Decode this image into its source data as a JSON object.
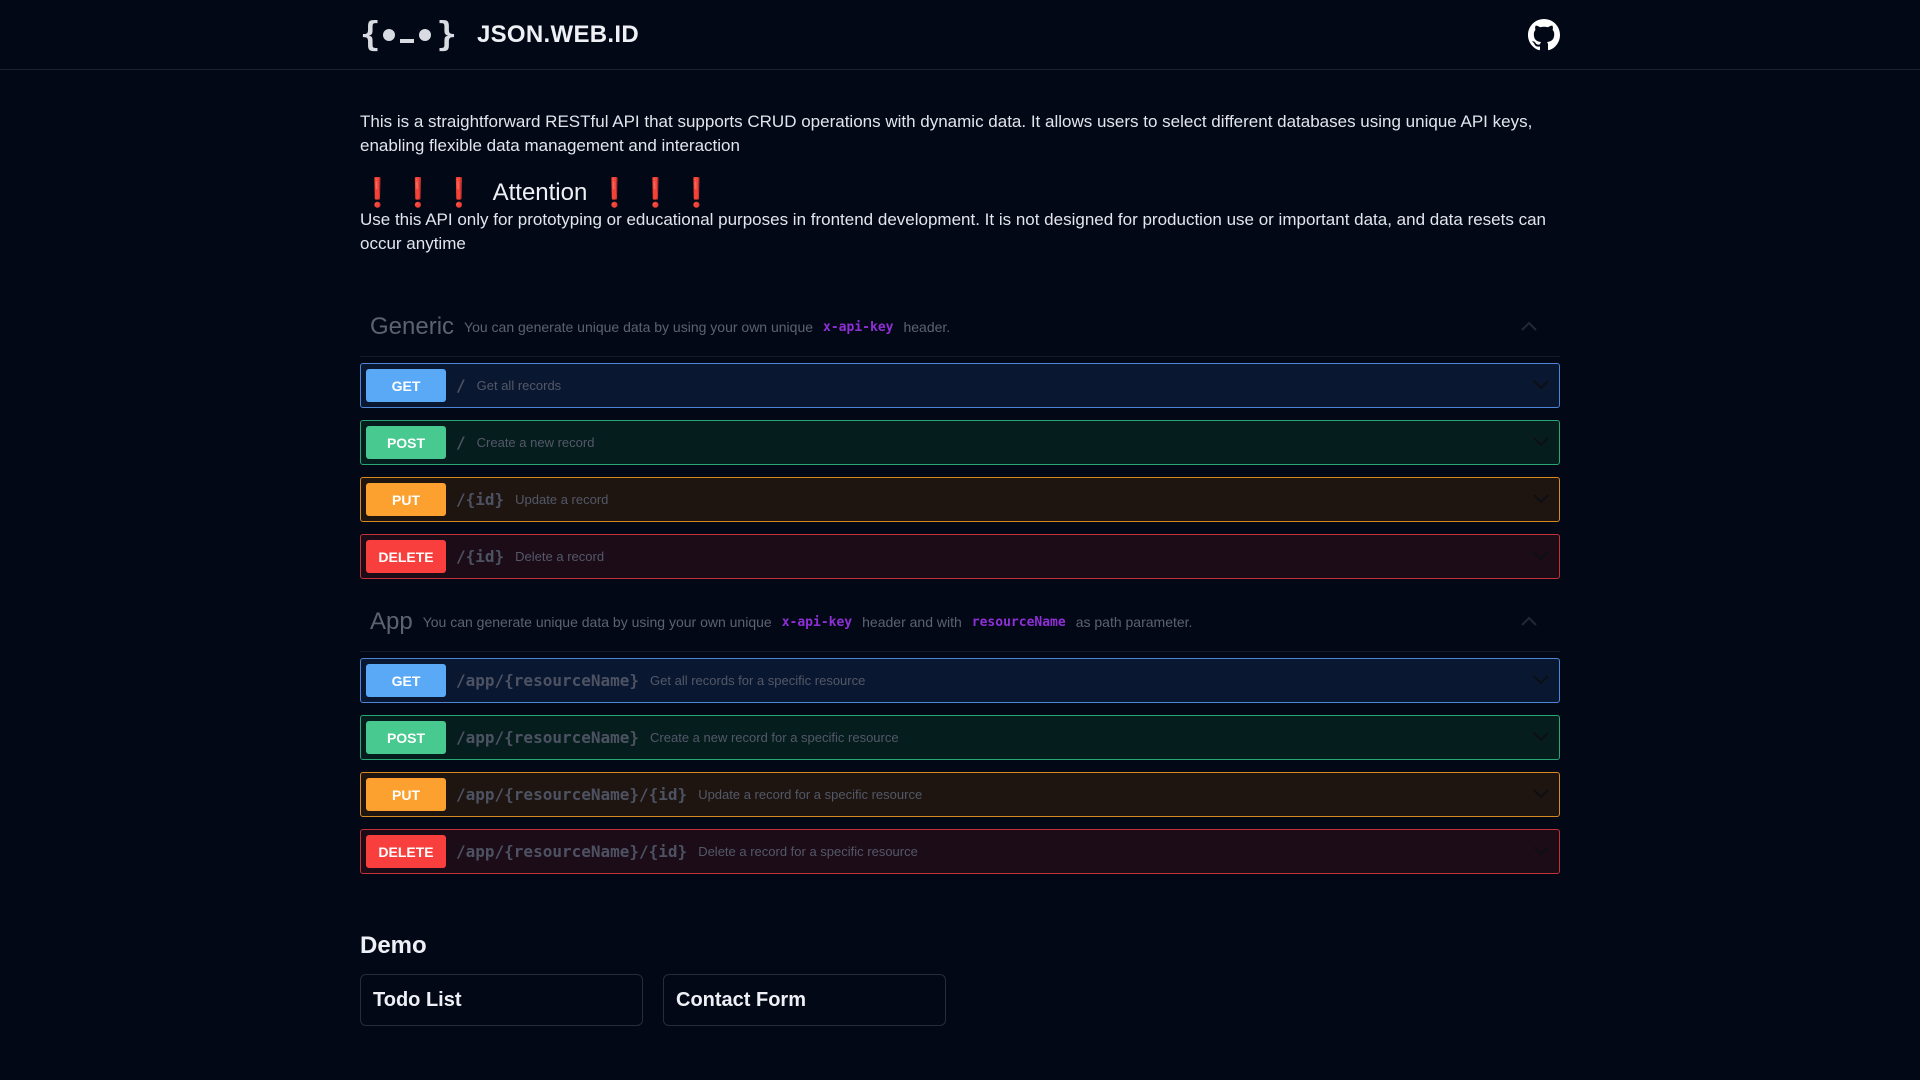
{
  "header": {
    "site_name": "JSON.WEB.ID"
  },
  "intro": "This is a straightforward RESTful API that supports CRUD operations with dynamic data. It allows users to select different databases using unique API keys, enabling flexible data management and interaction",
  "attention": {
    "marks_left": "❗❗❗",
    "title": "Attention",
    "marks_right": "❗❗❗",
    "text": "Use this API only for prototyping or educational purposes in frontend development. It is not designed for production use or important data, and data resets can occur anytime"
  },
  "generic": {
    "title": "Generic",
    "desc_prefix": "You can generate unique data by using your own unique",
    "key": "x-api-key",
    "desc_suffix": "header.",
    "ops": [
      {
        "method": "GET",
        "path": "/",
        "desc": "Get all records"
      },
      {
        "method": "POST",
        "path": "/",
        "desc": "Create a new record"
      },
      {
        "method": "PUT",
        "path": "/{id}",
        "desc": "Update a record"
      },
      {
        "method": "DELETE",
        "path": "/{id}",
        "desc": "Delete a record"
      }
    ]
  },
  "app": {
    "title": "App",
    "desc_prefix": "You can generate unique data by using your own unique",
    "key": "x-api-key",
    "desc_mid": "header and with",
    "param": "resourceName",
    "desc_suffix": "as path parameter.",
    "ops": [
      {
        "method": "GET",
        "path": "/app/{resourceName}",
        "desc": "Get all records for a specific resource"
      },
      {
        "method": "POST",
        "path": "/app/{resourceName}",
        "desc": "Create a new record for a specific resource"
      },
      {
        "method": "PUT",
        "path": "/app/{resourceName}/{id}",
        "desc": "Update a record for a specific resource"
      },
      {
        "method": "DELETE",
        "path": "/app/{resourceName}/{id}",
        "desc": "Delete a record for a specific resource"
      }
    ]
  },
  "demo": {
    "title": "Demo",
    "cards": [
      "Todo List",
      "Contact Form"
    ]
  },
  "icons": {
    "logo": "curly-brace-face-logo",
    "github": "github-icon",
    "chevron": "chevron-down-icon",
    "collapse": "chevron-up-icon"
  }
}
